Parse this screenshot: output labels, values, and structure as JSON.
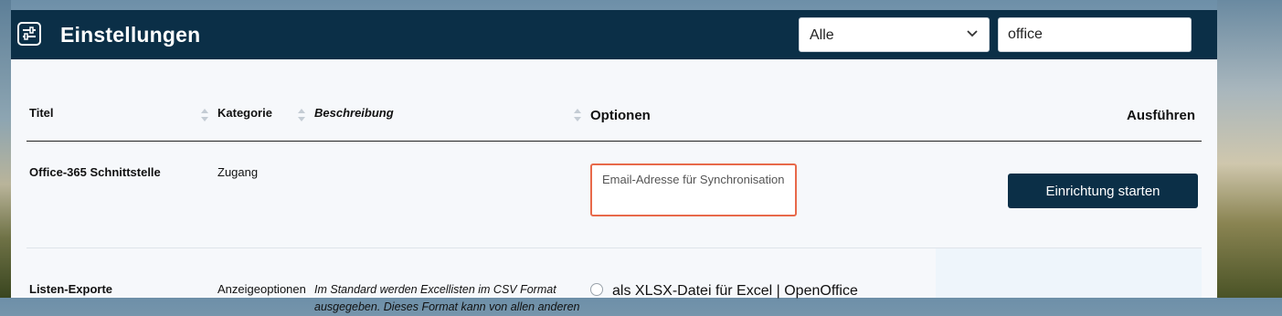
{
  "header": {
    "title": "Einstellungen",
    "icon": "settings-sliders-icon",
    "filter_select": {
      "value": "Alle"
    },
    "search": {
      "value": "office"
    }
  },
  "table": {
    "columns": {
      "title": "Titel",
      "category": "Kategorie",
      "description": "Beschreibung",
      "options": "Optionen",
      "execute": "Ausführen"
    },
    "rows": [
      {
        "title": "Office-365 Schnittstelle",
        "category": "Zugang",
        "description": "",
        "option_placeholder": "Email-Adresse für Synchronisation",
        "action_label": "Einrichtung starten"
      },
      {
        "title": "Listen-Exporte",
        "category": "Anzeigeoptionen",
        "description": "Im Standard werden Excellisten im CSV Format ausgegeben. Dieses Format kann von allen anderen",
        "option_radio_label": "als XLSX-Datei für Excel | OpenOffice"
      }
    ]
  },
  "colors": {
    "header_bg": "#0b2f47",
    "highlight_border": "#e8694a",
    "button_bg": "#0b2f47"
  }
}
